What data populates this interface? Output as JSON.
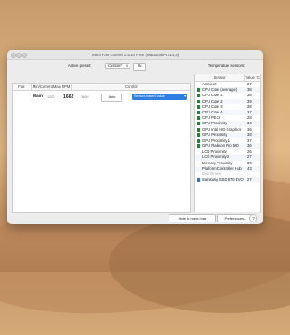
{
  "window": {
    "title": "Macs Fan Control 1.5.10 Free (MacBookPro14,3)"
  },
  "toolbar": {
    "preset_label": "Active preset:",
    "preset_value": "Custom*",
    "gear_symbol": "⚙"
  },
  "fans": {
    "headers": {
      "fan": "Fan",
      "rpm": "Min/Current/Max RPM",
      "control": "Control"
    },
    "rows": [
      {
        "name": "Main",
        "min": "1200",
        "current": "1662",
        "max": "3600",
        "auto_label": "Auto",
        "sensor_label": "Sensor-based value"
      }
    ]
  },
  "sensors": {
    "title": "Temperature sensors:",
    "headers": {
      "sensor": "Sensor",
      "value": "Value °C"
    },
    "rows": [
      {
        "name": "Ambient",
        "value": "27",
        "icon": "none"
      },
      {
        "name": "CPU Core (average)",
        "value": "38",
        "icon": "chip"
      },
      {
        "name": "CPU Core 1",
        "value": "38",
        "icon": "chip"
      },
      {
        "name": "CPU Core 2",
        "value": "39",
        "icon": "chip"
      },
      {
        "name": "CPU Core 3",
        "value": "38",
        "icon": "chip"
      },
      {
        "name": "CPU Core 4",
        "value": "37",
        "icon": "chip"
      },
      {
        "name": "CPU PECI",
        "value": "28",
        "icon": "chip"
      },
      {
        "name": "CPU Proximity",
        "value": "34",
        "icon": "chip"
      },
      {
        "name": "GPU Intel HD Graphics",
        "value": "36",
        "icon": "chip"
      },
      {
        "name": "GPU Proximity",
        "value": "38",
        "icon": "chip"
      },
      {
        "name": "GPU Proximity 1",
        "value": "37",
        "icon": "chip"
      },
      {
        "name": "GPU Radeon Pro 560",
        "value": "36",
        "icon": "chip"
      },
      {
        "name": "LCD Proximity",
        "value": "26",
        "icon": "none"
      },
      {
        "name": "LCD Proximity 2",
        "value": "27",
        "icon": "none"
      },
      {
        "name": "Memory Proximity",
        "value": "30",
        "icon": "none"
      },
      {
        "name": "Platform Controller Hub",
        "value": "43",
        "icon": "none"
      },
      {
        "name": "Disk Drives:",
        "value": "",
        "icon": "none",
        "dim": true
      },
      {
        "name": "Samsung SSD 970 EVO Plus",
        "value": "27",
        "icon": "ssd"
      }
    ]
  },
  "buttons": {
    "hide": "Hide to menu bar",
    "preferences": "Preferences...",
    "help": "?"
  }
}
